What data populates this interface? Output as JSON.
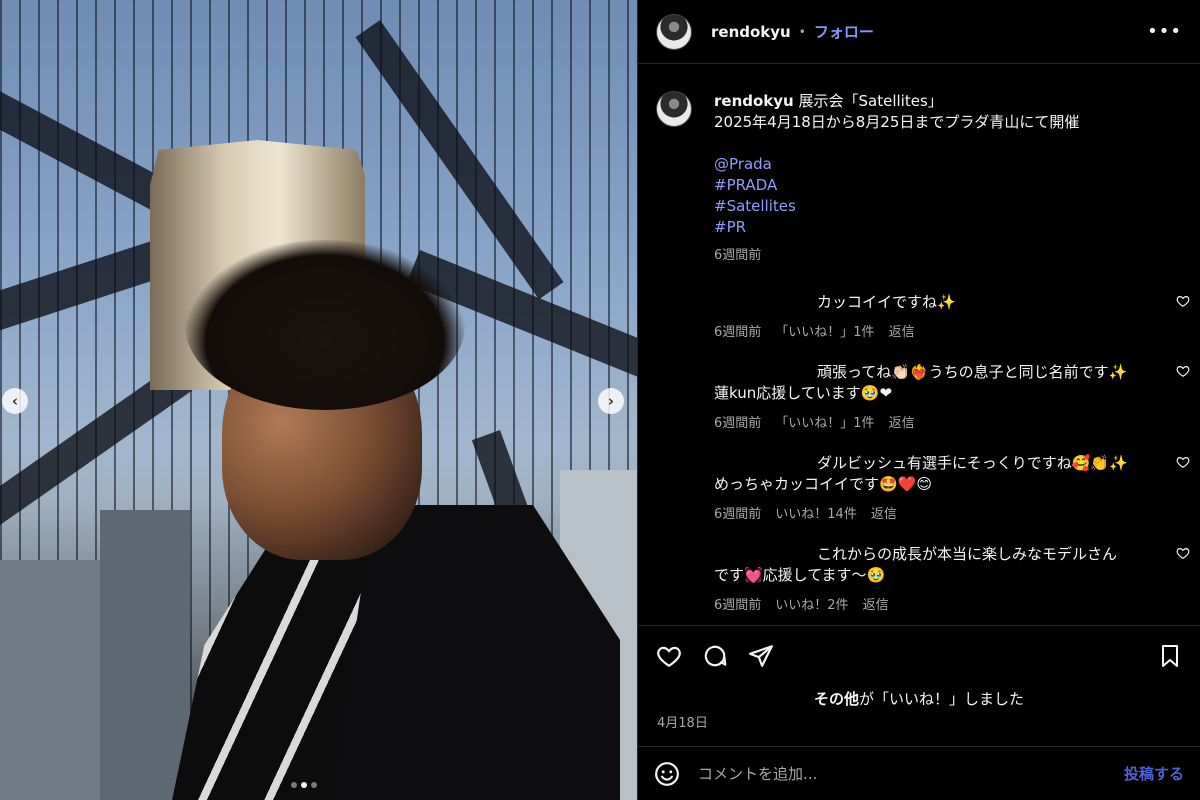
{
  "post": {
    "username": "rendokyu",
    "separator": "•",
    "follow_label": "フォロー",
    "more_label": "•••"
  },
  "caption": {
    "username": "rendokyu",
    "title": "展示会「Satellites」",
    "line2": "2025年4月18日から8月25日までプラダ青山にて開催",
    "tags": [
      "@Prada",
      "#PRADA",
      "#Satellites",
      "#PR"
    ],
    "time": "6週間前"
  },
  "comments": [
    {
      "line1": "カッコイイですね✨",
      "line2": "",
      "time": "6週間前",
      "likes": "「いいね！」1件",
      "reply": "返信"
    },
    {
      "line1": "頑張ってね👏🏻❤️‍🔥うちの息子と同じ名前です✨",
      "line2": "蓮kun応援しています🥹❤",
      "time": "6週間前",
      "likes": "「いいね！」1件",
      "reply": "返信"
    },
    {
      "line1": "ダルビッシュ有選手にそっくりですね🥰👏✨",
      "line2": "めっちゃカッコイイです🤩❤️😊",
      "time": "6週間前",
      "likes": "いいね！14件",
      "reply": "返信"
    },
    {
      "line1": "これからの成長が本当に楽しみなモデルさん",
      "line2": "です💓応援してます〜🥹",
      "time": "6週間前",
      "likes": "いいね！2件",
      "reply": "返信"
    }
  ],
  "likes_text": {
    "bold": "その他",
    "rest": "が「いいね！」しました"
  },
  "date": "4月18日",
  "composer": {
    "placeholder": "コメントを追加...",
    "post_label": "投稿する"
  },
  "carousel": {
    "prev": "‹",
    "next": "›",
    "slide_count": 3,
    "active_slide": 2
  },
  "colors": {
    "link": "#8f9cff",
    "follow": "#8797ff",
    "post_button": "#4f5fd6",
    "muted": "#a8a8a8",
    "background": "#000000"
  },
  "icons": [
    "heart-icon",
    "comment-icon",
    "share-icon",
    "bookmark-icon",
    "emoji-icon",
    "small-heart-icon"
  ]
}
